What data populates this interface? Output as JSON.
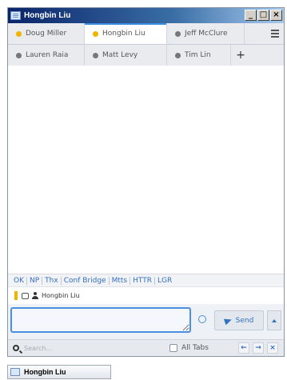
{
  "window": {
    "title": "Hongbin Liu",
    "controls": [
      "_",
      "□",
      "×"
    ]
  },
  "tabs_row1": [
    {
      "label": "Doug Miller",
      "status": "yellow"
    },
    {
      "label": "Hongbin Liu",
      "status": "yellow",
      "active": true
    },
    {
      "label": "Jeff McClure",
      "status": "gray"
    }
  ],
  "tabs_row2": [
    {
      "label": "Lauren Raia",
      "status": "gray"
    },
    {
      "label": "Matt Levy",
      "status": "gray"
    },
    {
      "label": "Tim Lin",
      "status": "gray"
    }
  ],
  "add_tab_label": "+",
  "quick_replies": [
    "OK",
    "NP",
    "Thx",
    "Conf Bridge",
    "Mtts",
    "HTTR",
    "LGR"
  ],
  "typing_user": "Hongbin Liu",
  "compose": {
    "placeholder": "",
    "send_label": "Send"
  },
  "search": {
    "placeholder": "Search...",
    "all_tabs_label": "All Tabs",
    "nav": [
      "←",
      "→",
      "×"
    ]
  },
  "taskbar": {
    "label": "Hongbin Liu"
  },
  "colors": {
    "accent": "#3470c0",
    "status_available": "#f0b400",
    "status_offline": "#777777",
    "titlebar": "#0a246a"
  }
}
